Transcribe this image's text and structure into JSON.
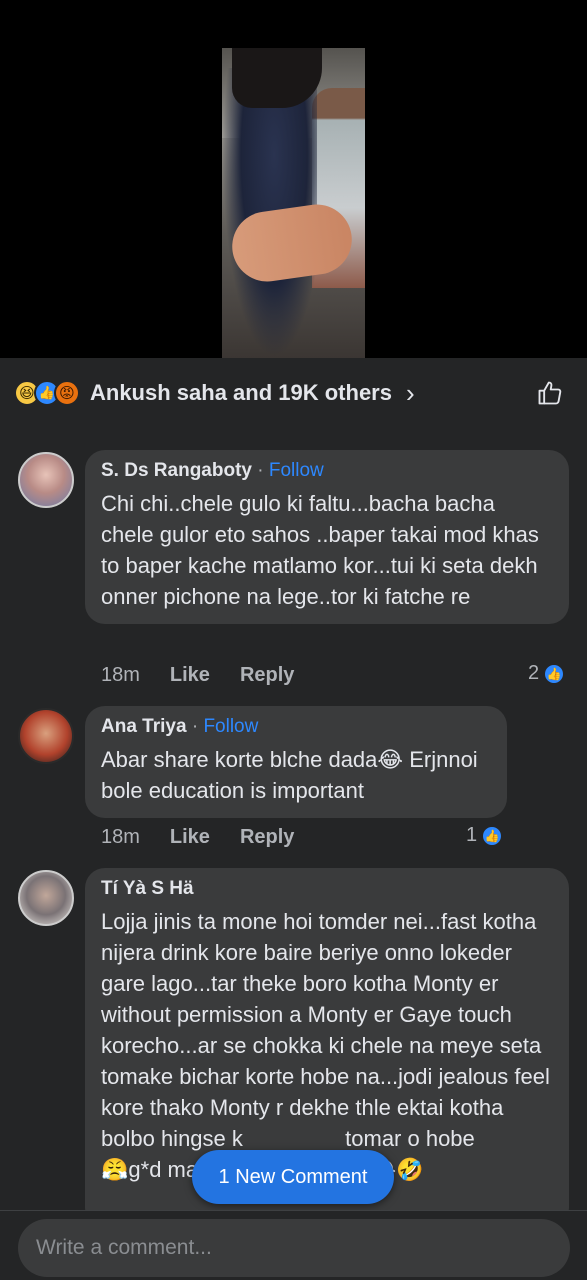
{
  "reactions": {
    "icons": [
      "haha",
      "like",
      "angry"
    ],
    "summary": "Ankush saha and 19K others",
    "chevron": "›"
  },
  "comments": [
    {
      "author": "S. Ds Rangaboty",
      "separator": "·",
      "follow": "Follow",
      "text": "Chi chi..chele gulo ki faltu...bacha bacha chele gulor eto sahos ..baper takai mod khas to baper kache matlamo kor...tui ki seta dekh onner pichone na lege..tor ki fatche re",
      "time": "18m",
      "like": "Like",
      "reply": "Reply",
      "reaction_count": "2"
    },
    {
      "author": "Ana Triya",
      "separator": "·",
      "follow": "Follow",
      "text": "Abar share korte blche dada😂 Erjnnoi bole education is important",
      "time": "18m",
      "like": "Like",
      "reply": "Reply",
      "reaction_count": "1"
    },
    {
      "author": "Tí Yà S Hä",
      "text": "Lojja jinis ta mone hoi tomder nei...fast kotha nijera drink kore baire beriye onno lokeder gare lago...tar theke boro kotha Monty er without permission a Monty er Gaye touch korecho...ar se chokka ki chele na meye seta tomake bichar korte hobe na...jodi jealous feel kore thako Monty r dekhe thle ektai kotha bolbo hingse k",
      "text_tail": "tomar o hobe",
      "text_last": "😤g*d marani ektu brik sala😂🤣"
    }
  ],
  "new_comment_pill": "1 New Comment",
  "composer": {
    "placeholder": "Write a comment..."
  },
  "colors": {
    "accent": "#2d88ff",
    "background": "#242526",
    "bubble": "#3a3b3c"
  }
}
